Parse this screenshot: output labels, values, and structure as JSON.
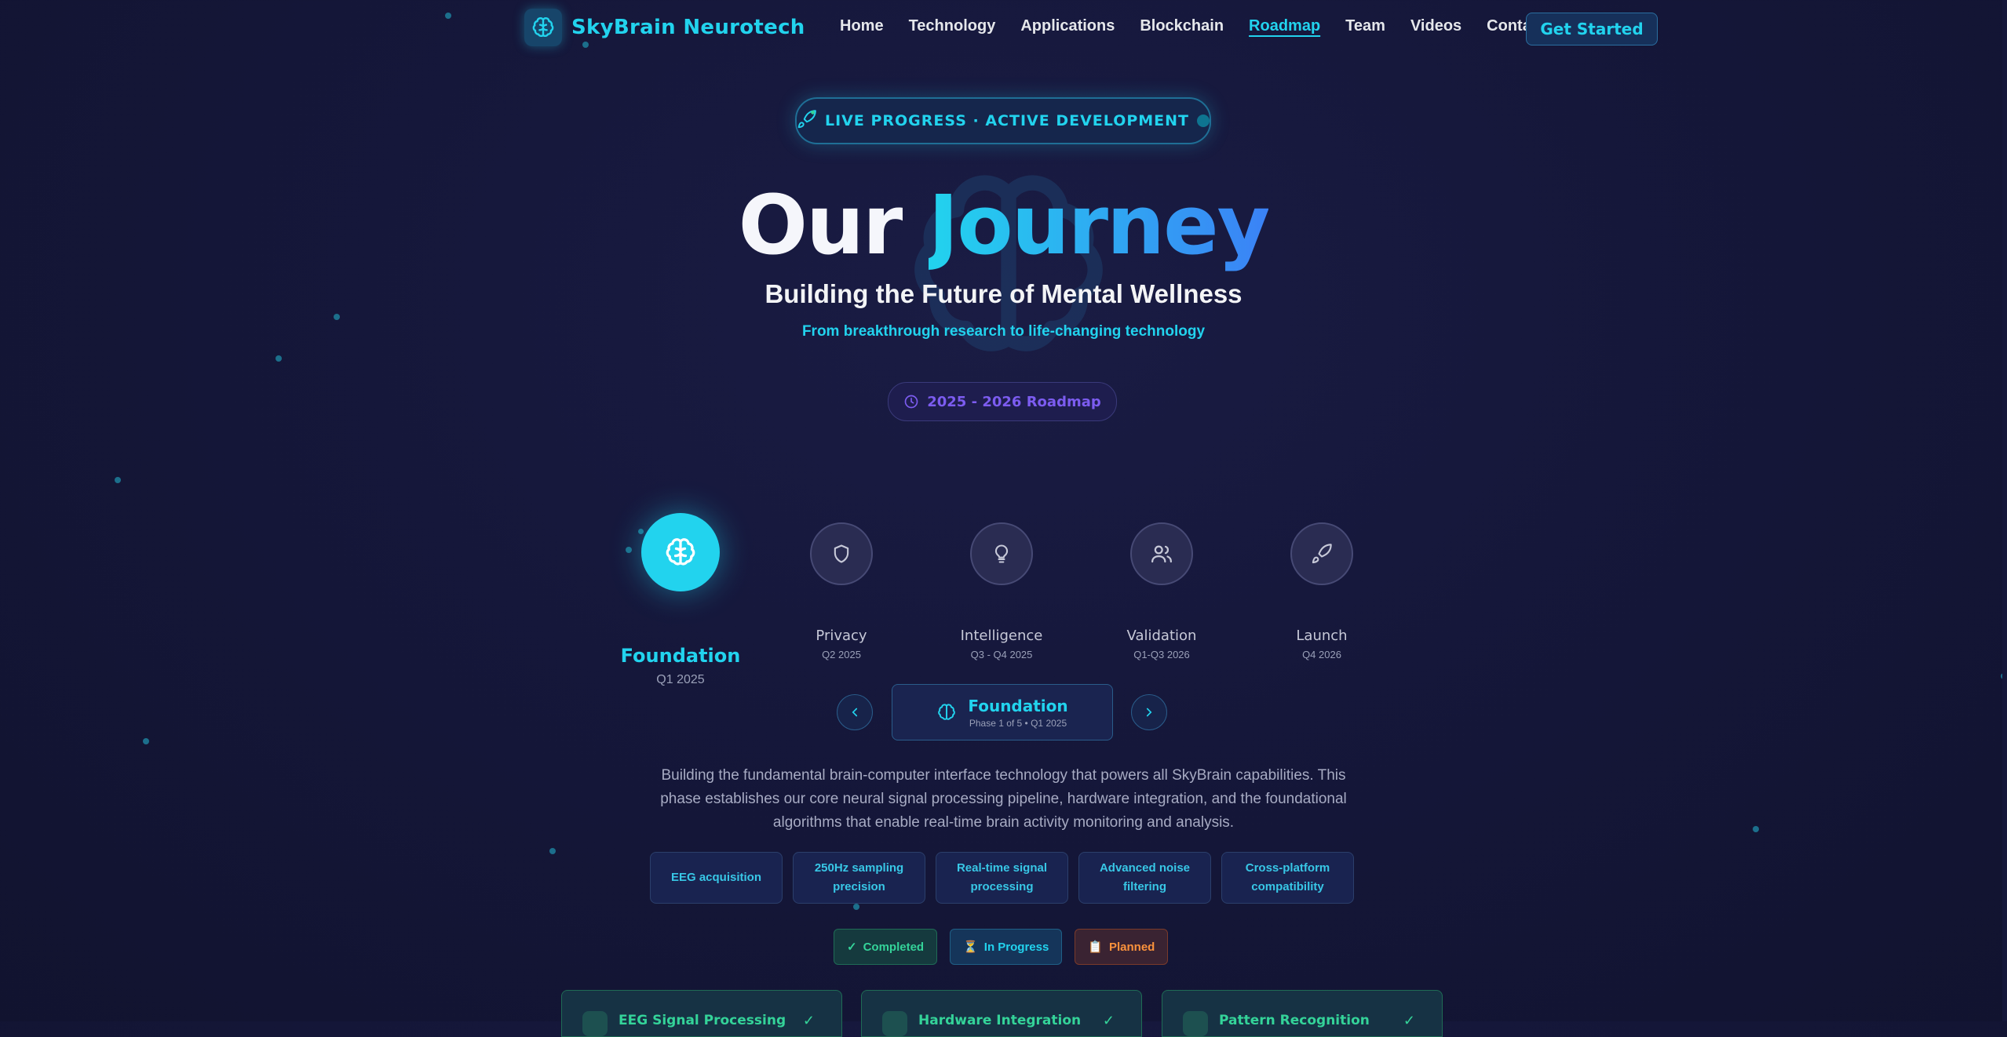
{
  "brand": {
    "name": "SkyBrain Neurotech",
    "icon": "brain-icon"
  },
  "nav": {
    "links": [
      "Home",
      "Technology",
      "Applications",
      "Blockchain",
      "Roadmap",
      "Team",
      "Videos",
      "Contact"
    ],
    "active": "Roadmap",
    "cta": "Get Started"
  },
  "hero": {
    "pill": "LIVE PROGRESS · ACTIVE DEVELOPMENT",
    "title_white": "Our",
    "title_accent": "Journey",
    "subtitle": "Building the Future of Mental Wellness",
    "tagline": "From breakthrough research to life-changing technology",
    "years": "2025 - 2026 Roadmap"
  },
  "phases": [
    {
      "name": "Foundation",
      "date": "Q1 2025",
      "icon": "brain-icon",
      "active": true
    },
    {
      "name": "Privacy",
      "date": "Q2 2025",
      "icon": "shield-icon"
    },
    {
      "name": "Intelligence",
      "date": "Q3 - Q4 2025",
      "icon": "lightbulb-icon"
    },
    {
      "name": "Validation",
      "date": "Q1-Q3 2026",
      "icon": "users-icon"
    },
    {
      "name": "Launch",
      "date": "Q4 2026",
      "icon": "rocket-icon"
    }
  ],
  "current": {
    "title": "Foundation",
    "sub": "Phase 1 of 5 • Q1 2025"
  },
  "description": "Building the fundamental brain-computer interface technology that powers all SkyBrain capabilities. This phase establishes our core neural signal processing pipeline, hardware integration, and the foundational algorithms that enable real-time brain activity monitoring and analysis.",
  "features": [
    "EEG acquisition",
    "250Hz sampling precision",
    "Real-time signal processing",
    "Advanced noise filtering",
    "Cross-platform compatibility"
  ],
  "statuses": [
    {
      "label": "Completed",
      "icon": "✓"
    },
    {
      "label": "In Progress",
      "icon": "⏳"
    },
    {
      "label": "Planned",
      "icon": "📋"
    }
  ],
  "tasks": [
    {
      "title": "EEG Signal Processing",
      "check": "✓"
    },
    {
      "title": "Hardware Integration",
      "check": "✓"
    },
    {
      "title": "Pattern Recognition",
      "check": "✓"
    }
  ],
  "colors": {
    "accent": "#22d3ee",
    "secondary": "#3b82f6",
    "completed": "#34d399",
    "planned": "#fb923c",
    "purple": "#7c5cf0"
  }
}
